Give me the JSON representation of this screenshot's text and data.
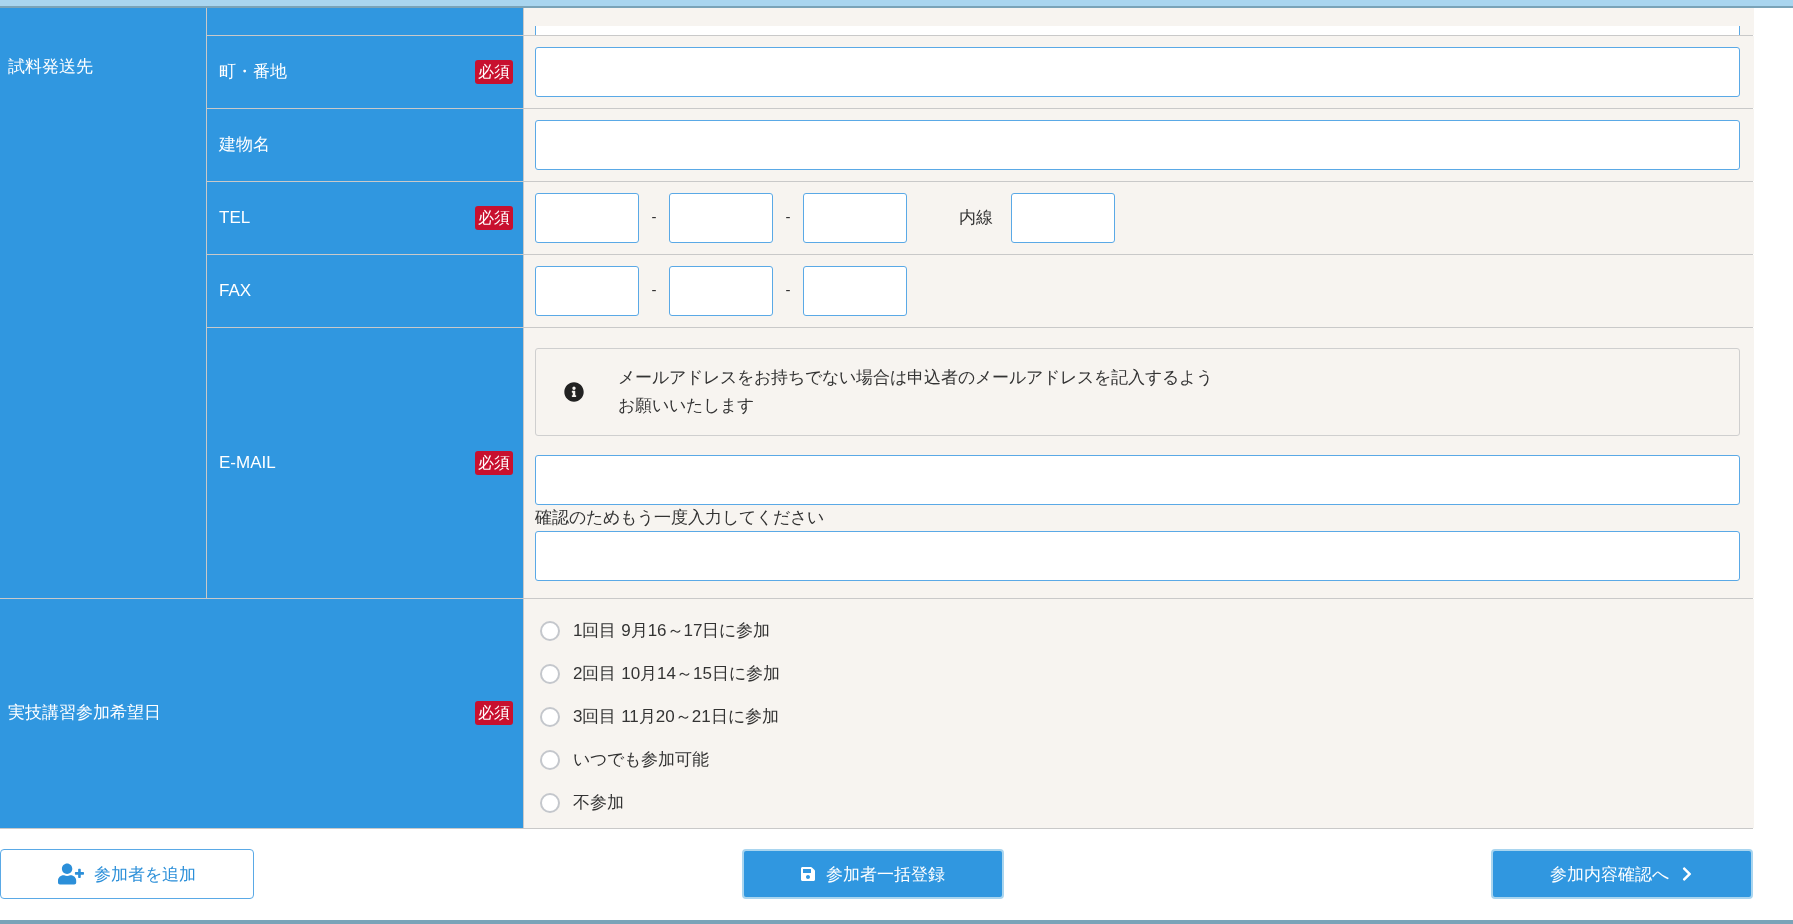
{
  "shipping": {
    "label": "試料発送先",
    "rows": [
      {
        "kind": "partial"
      },
      {
        "kind": "text",
        "label": "町・番地",
        "badge": "必須"
      },
      {
        "kind": "text",
        "label": "建物名"
      },
      {
        "kind": "phone",
        "label": "TEL",
        "badge": "必須",
        "separators": [
          "-",
          "-"
        ],
        "extension_label": "内線"
      },
      {
        "kind": "phone",
        "label": "FAX",
        "separators": [
          "-",
          "-"
        ]
      },
      {
        "kind": "email",
        "label": "E-MAIL",
        "badge": "必須",
        "notice_lines": [
          "メールアドレスをお持ちでない場合は申込者のメールアドレスを記入するよう",
          "お願いいたします"
        ],
        "confirm_label": "確認のためもう一度入力してください"
      }
    ]
  },
  "date_choice": {
    "label": "実技講習参加希望日",
    "badge": "必須",
    "options": [
      {
        "label": "1回目 9月16～17日に参加",
        "selected": false
      },
      {
        "label": "2回目 10月14～15日に参加",
        "selected": false
      },
      {
        "label": "3回目 11月20～21日に参加",
        "selected": false
      },
      {
        "label": "いつでも参加可能",
        "selected": false
      },
      {
        "label": "不参加",
        "selected": false
      }
    ]
  },
  "buttons": [
    {
      "label": "参加者を追加",
      "kind": "add"
    },
    {
      "label": "参加者一括登録",
      "kind": "save"
    },
    {
      "label": "参加内容確認へ",
      "kind": "next"
    }
  ]
}
